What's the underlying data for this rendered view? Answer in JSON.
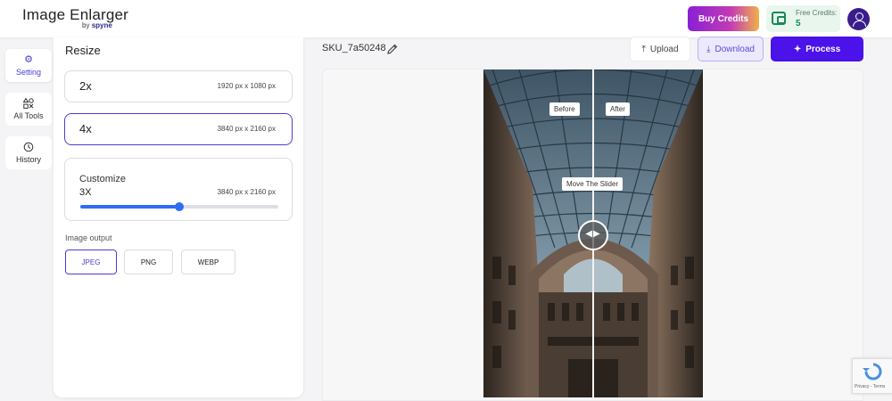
{
  "header": {
    "app_title": "Image Enlarger",
    "app_sub_prefix": "by",
    "app_sub_brand": "spyne",
    "buy_credits_label": "Buy Credits",
    "free_credits_label": "Free Credits:",
    "free_credits_value": "5"
  },
  "rail": {
    "items": [
      {
        "label": "Setting",
        "icon": "gear-icon"
      },
      {
        "label": "All Tools",
        "icon": "tools-grid-icon"
      },
      {
        "label": "History",
        "icon": "history-icon"
      }
    ]
  },
  "settings": {
    "title": "Resize",
    "options": [
      {
        "scale": "2x",
        "dims": "1920 px x 1080 px"
      },
      {
        "scale": "4x",
        "dims": "3840 px x 2160 px"
      }
    ],
    "customize": {
      "label": "Customize",
      "scale": "3X",
      "dims": "3840 px x 2160 px",
      "slider_fraction": 0.5
    },
    "output_label": "Image output",
    "formats": [
      "JPEG",
      "PNG",
      "WEBP"
    ],
    "selected_format": "JPEG"
  },
  "main": {
    "sku": "SKU_7a50248",
    "upload_label": "Upload",
    "download_label": "Download",
    "process_label": "Process",
    "before_label": "Before",
    "after_label": "After",
    "slider_hint": "Move The Slider",
    "recaptcha_text": "Privacy - Terms"
  },
  "colors": {
    "accent": "#4b12ea",
    "selected_border": "#4a3fd1",
    "slider": "#2d6cf5",
    "credits_green": "#178a55"
  }
}
